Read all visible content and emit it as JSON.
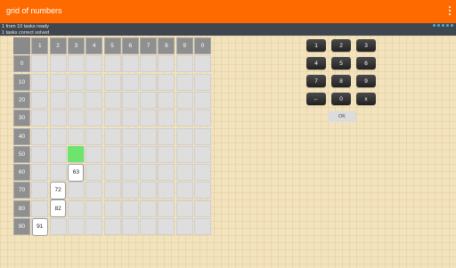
{
  "app": {
    "title": "grid of numbers"
  },
  "status": {
    "line1": "1 from 10 tasks ready",
    "line2": "1 tasks correct solved"
  },
  "grid": {
    "col_headers": [
      "1",
      "2",
      "3",
      "4",
      "5",
      "6",
      "7",
      "8",
      "9",
      "0"
    ],
    "row_headers": [
      "0",
      "10",
      "20",
      "30",
      "40",
      "50",
      "60",
      "70",
      "80",
      "90"
    ],
    "answers": [
      {
        "value": "63"
      },
      {
        "value": "72"
      },
      {
        "value": "82"
      },
      {
        "value": "91"
      }
    ]
  },
  "keypad": {
    "keys": [
      "1",
      "2",
      "3",
      "4",
      "5",
      "6",
      "7",
      "8",
      "9",
      "←",
      "0",
      "x"
    ],
    "ok_label": "OK"
  },
  "colors": {
    "appbar": "#ff6a00",
    "statusbar": "#40464f",
    "selected_cell": "#6ee36e",
    "background": "#f3e3bd"
  }
}
